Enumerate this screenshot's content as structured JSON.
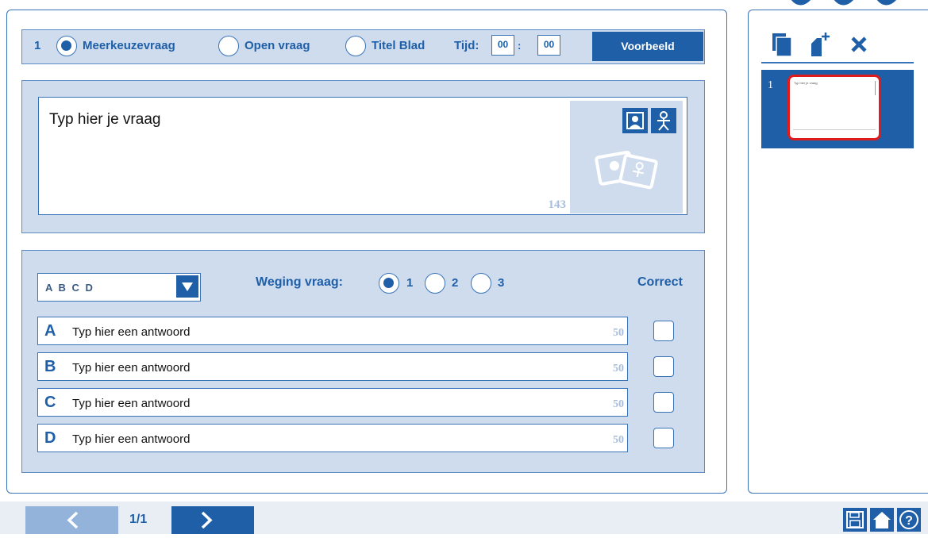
{
  "question": {
    "number": "1",
    "types": [
      {
        "label": "Meerkeuzevraag",
        "selected": true
      },
      {
        "label": "Open vraag",
        "selected": false
      },
      {
        "label": "Titel Blad",
        "selected": false
      }
    ],
    "time_label": "Tijd:",
    "time_minutes": "00",
    "time_separator": ":",
    "time_seconds": "00",
    "preview_label": "Voorbeeld",
    "placeholder": "Typ hier je vraag",
    "char_count": "143",
    "media_icons": [
      "image-upload-icon",
      "avatar-icon",
      "images-placeholder-icon"
    ]
  },
  "answers": {
    "format_value": "A B C D",
    "weging_label": "Weging vraag:",
    "weging_options": [
      {
        "label": "1",
        "selected": true
      },
      {
        "label": "2",
        "selected": false
      },
      {
        "label": "3",
        "selected": false
      }
    ],
    "correct_label": "Correct",
    "items": [
      {
        "letter": "A",
        "placeholder": "Typ hier een antwoord",
        "count": "50",
        "correct": false
      },
      {
        "letter": "B",
        "placeholder": "Typ hier een antwoord",
        "count": "50",
        "correct": false
      },
      {
        "letter": "C",
        "placeholder": "Typ hier een antwoord",
        "count": "50",
        "correct": false
      },
      {
        "letter": "D",
        "placeholder": "Typ hier een antwoord",
        "count": "50",
        "correct": false
      }
    ]
  },
  "sidebar": {
    "icons": [
      "copy-icon",
      "add-page-icon",
      "delete-icon"
    ],
    "slides": [
      {
        "number": "1",
        "thumb_text": "Typ hier je vraag",
        "selected": true
      }
    ]
  },
  "footer": {
    "page": "1/1",
    "icons": [
      "save-icon",
      "home-icon",
      "help-icon"
    ]
  },
  "colors": {
    "primary": "#1f5fa8",
    "panel_bg": "#cfdced",
    "muted_count": "#a6bedd",
    "selected_slide_border": "#e01b1b"
  }
}
